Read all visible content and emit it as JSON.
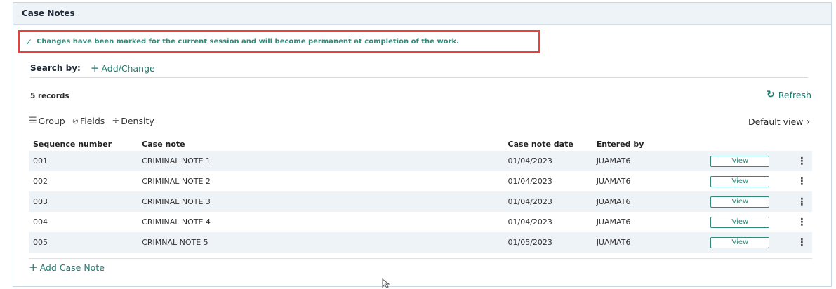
{
  "panel": {
    "title": "Case Notes"
  },
  "alert": {
    "icon": "check-icon",
    "message": "Changes have been marked for the current session and will become permanent at completion of the work."
  },
  "search": {
    "label": "Search by:",
    "add_change_label": "Add/Change"
  },
  "records_count": "5 records",
  "refresh_label": "Refresh",
  "toolbar": {
    "group_label": "Group",
    "fields_label": "Fields",
    "density_label": "Density",
    "default_view_label": "Default view"
  },
  "table": {
    "columns": [
      "Sequence number",
      "Case note",
      "Case note date",
      "Entered by"
    ],
    "rows": [
      {
        "seq": "001",
        "note": "CRIMINAL NOTE 1",
        "date": "01/04/2023",
        "by": "JUAMAT6",
        "action": "View"
      },
      {
        "seq": "002",
        "note": "CRIMINAL NOTE 2",
        "date": "01/04/2023",
        "by": "JUAMAT6",
        "action": "View"
      },
      {
        "seq": "003",
        "note": "CRIMINAL NOTE 3",
        "date": "01/04/2023",
        "by": "JUAMAT6",
        "action": "View"
      },
      {
        "seq": "004",
        "note": "CRIMINAL NOTE 4",
        "date": "01/04/2023",
        "by": "JUAMAT6",
        "action": "View"
      },
      {
        "seq": "005",
        "note": "CRIMNAL NOTE 5",
        "date": "01/05/2023",
        "by": "JUAMAT6",
        "action": "View"
      }
    ]
  },
  "add_note_label": "Add Case Note",
  "colors": {
    "accent": "#1f7a6e",
    "alert_border": "#e8413b",
    "header_bg": "#eef3f8"
  }
}
